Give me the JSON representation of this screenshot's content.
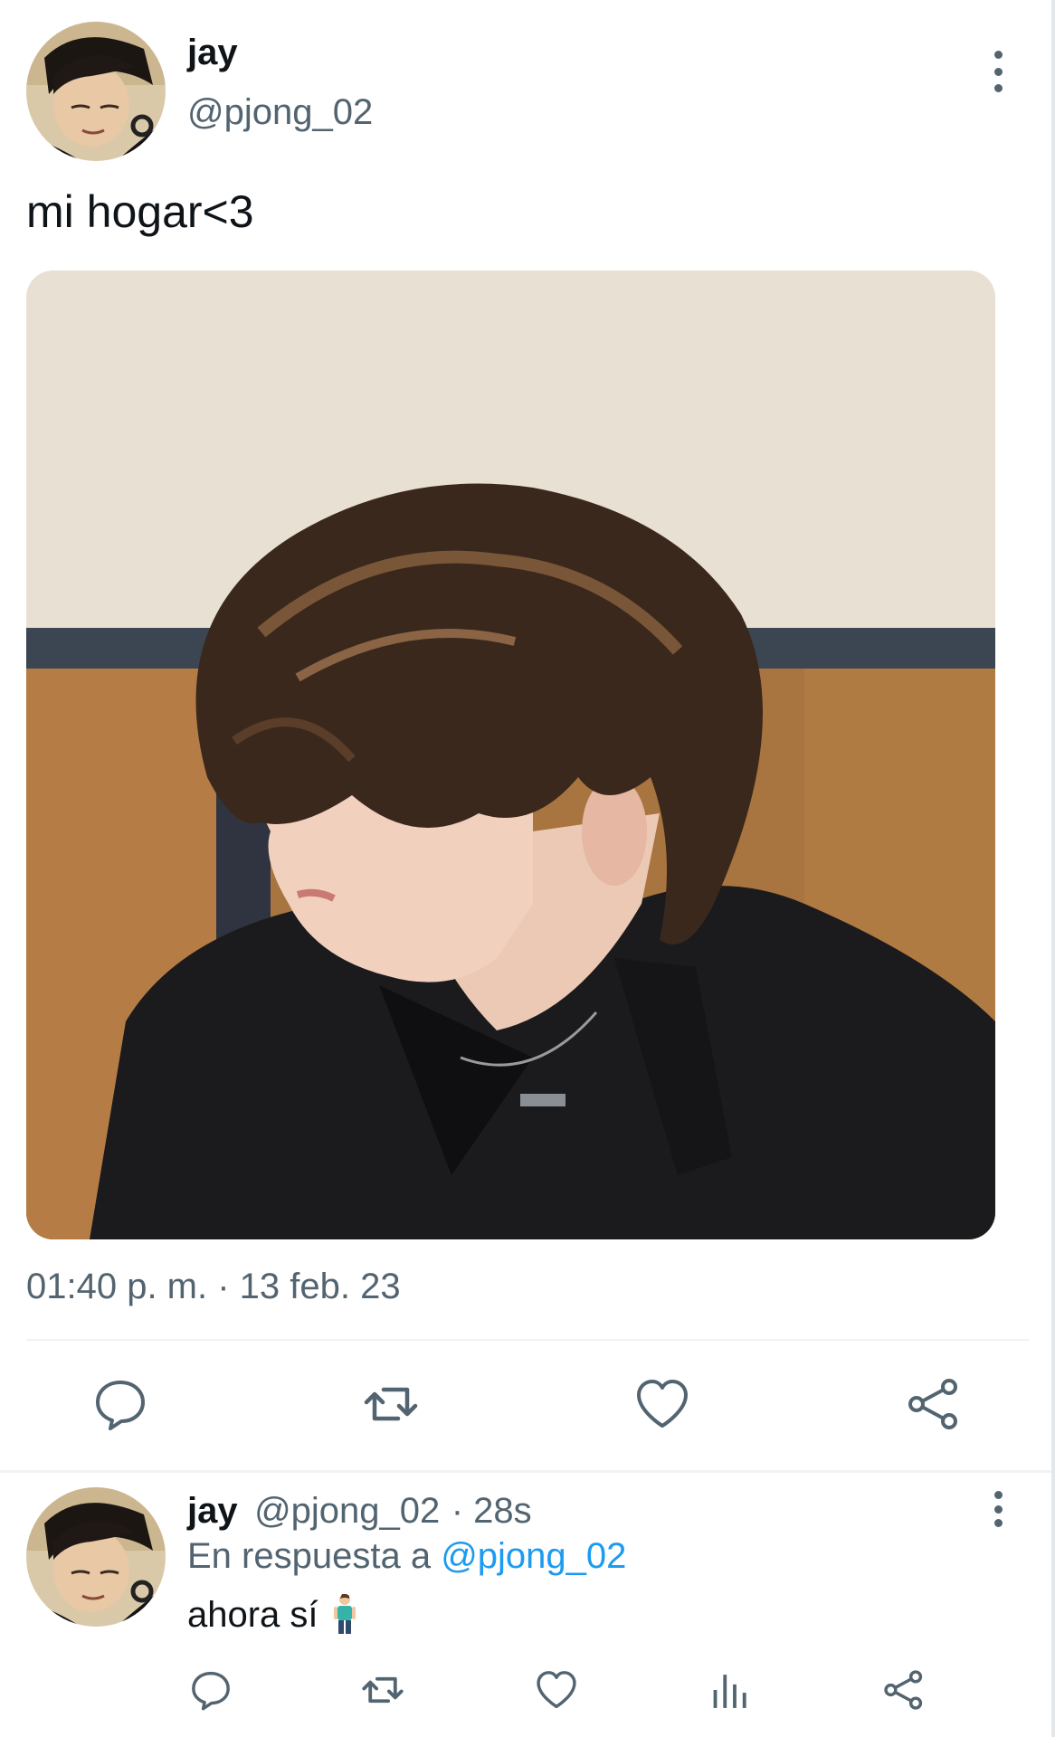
{
  "tweet": {
    "author": {
      "display_name": "jay",
      "handle": "@pjong_02",
      "avatar_icon": "avatar-photo"
    },
    "text": "mi hogar<3",
    "timestamp": "01:40 p. m. · 13 feb. 23",
    "actions": [
      {
        "name": "reply",
        "icon": "reply-icon"
      },
      {
        "name": "retweet",
        "icon": "retweet-icon"
      },
      {
        "name": "like",
        "icon": "heart-icon"
      },
      {
        "name": "share",
        "icon": "share-icon"
      }
    ]
  },
  "reply": {
    "author": {
      "display_name": "jay",
      "handle": "@pjong_02",
      "time_ago": "· 28s"
    },
    "in_reply_prefix": "En respuesta a",
    "in_reply_mention": "@pjong_02",
    "text": "ahora sí",
    "emoji": "person-standing-emoji",
    "actions": [
      {
        "name": "reply",
        "icon": "reply-icon"
      },
      {
        "name": "retweet",
        "icon": "retweet-icon"
      },
      {
        "name": "like",
        "icon": "heart-icon"
      },
      {
        "name": "analytics",
        "icon": "analytics-icon"
      },
      {
        "name": "share",
        "icon": "share-icon"
      }
    ]
  },
  "colors": {
    "text_primary": "#0f1419",
    "text_secondary": "#536471",
    "link": "#1d9bf0",
    "divider": "#eff3f4"
  }
}
